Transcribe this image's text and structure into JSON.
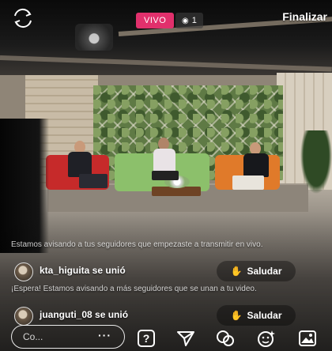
{
  "top_bar": {
    "switch_camera_icon": "switch-camera-icon",
    "live_label": "VIVO",
    "viewer_count": "1",
    "viewer_icon": "eye-icon",
    "end_label": "Finalizar"
  },
  "comments": {
    "notice_1": "Estamos avisando a tus seguidores que empezaste a transmitir en vivo.",
    "join_1": {
      "username": "kta_higuita",
      "text": "kta_higuita se unió",
      "greet_label": "Saludar"
    },
    "notice_2": "¡Espera! Estamos avisando a más seguidores que se unan a tu video.",
    "join_2": {
      "username": "juanguti_08",
      "text": "juanguti_08 se unió",
      "greet_label": "Saludar"
    }
  },
  "composer": {
    "placeholder": "Co...",
    "more_label": "···",
    "icons": [
      "question-icon",
      "send-icon",
      "add-guest-icon",
      "face-filter-icon",
      "gallery-icon"
    ]
  },
  "colors": {
    "live_badge": "#e1306c",
    "wave_emoji": "#ffca28"
  }
}
